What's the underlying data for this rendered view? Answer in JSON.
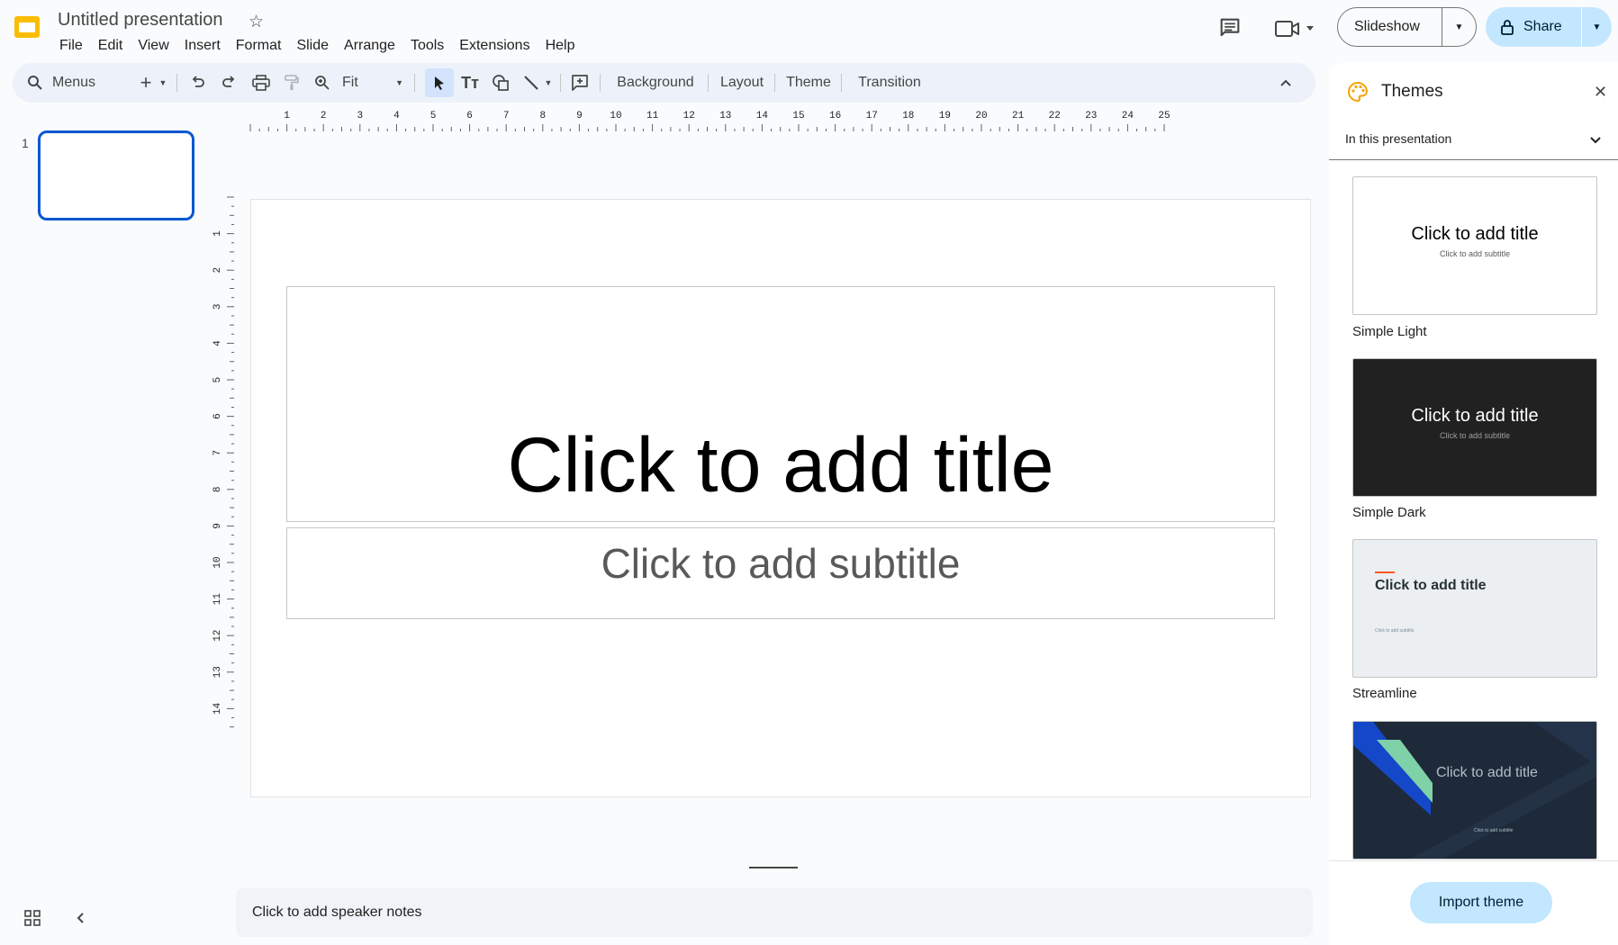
{
  "app": {
    "title": "Untitled presentation",
    "menus": [
      "File",
      "Edit",
      "View",
      "Insert",
      "Format",
      "Slide",
      "Arrange",
      "Tools",
      "Extensions",
      "Help"
    ],
    "brand_color": "#fbbc04"
  },
  "header": {
    "slideshow_label": "Slideshow",
    "share_label": "Share"
  },
  "toolbar": {
    "menus_label": "Menus",
    "zoom_value": "Fit",
    "background_label": "Background",
    "layout_label": "Layout",
    "theme_label": "Theme",
    "transition_label": "Transition"
  },
  "rulers": {
    "horizontal": [
      "1",
      "2",
      "3",
      "4",
      "5",
      "6",
      "7",
      "8",
      "9",
      "10",
      "11",
      "12",
      "13",
      "14",
      "15",
      "16",
      "17",
      "18",
      "19",
      "20",
      "21",
      "22",
      "23",
      "24",
      "25"
    ],
    "vertical": [
      "1",
      "2",
      "3",
      "4",
      "5",
      "6",
      "7",
      "8",
      "9",
      "10",
      "11",
      "12",
      "13",
      "14"
    ]
  },
  "filmstrip": {
    "slide_number": "1"
  },
  "slide": {
    "title_placeholder": "Click to add title",
    "subtitle_placeholder": "Click to add subtitle"
  },
  "notes": {
    "placeholder": "Click to add speaker notes"
  },
  "themes_panel": {
    "title": "Themes",
    "filter_label": "In this presentation",
    "themes": [
      {
        "name": "Simple Light",
        "title": "Click to add title",
        "subtitle": "Click to add subtitle"
      },
      {
        "name": "Simple Dark",
        "title": "Click to add title",
        "subtitle": "Click to add subtitle"
      },
      {
        "name": "Streamline",
        "title": "Click to add title",
        "subtitle": "Click to add subtitle"
      },
      {
        "name": "",
        "title": "Click to add title",
        "subtitle": "Click to add subtitle"
      }
    ],
    "import_label": "Import theme"
  }
}
